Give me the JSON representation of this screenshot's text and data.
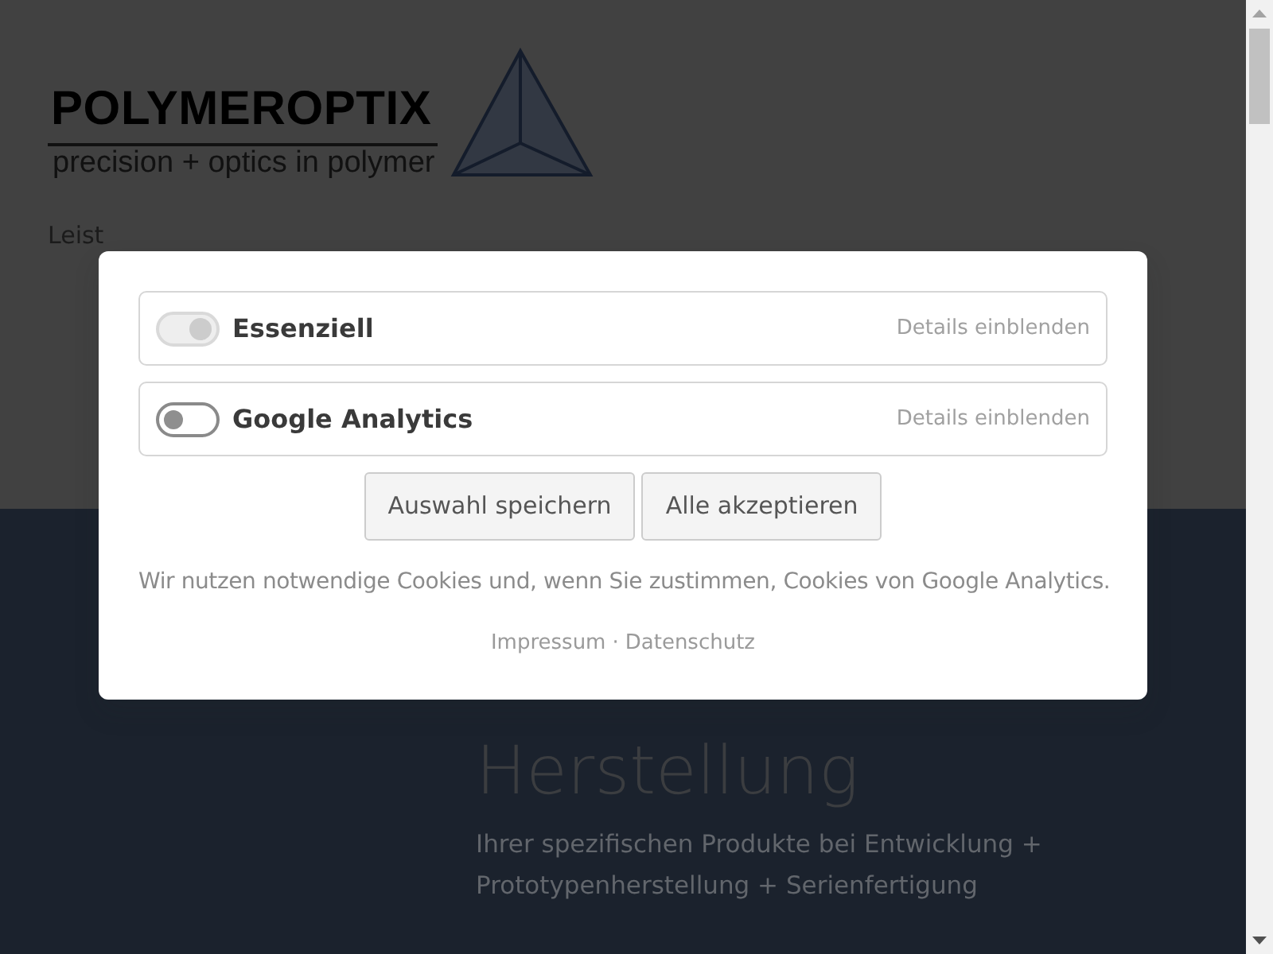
{
  "logo": {
    "name": "POLYMEROPTIX",
    "tagline": "precision + optics in polymer"
  },
  "nav": [
    {
      "label": "Leist"
    }
  ],
  "hero": {
    "title": "Herstellung",
    "subtitle": "Ihrer spezifischen Produkte bei Entwicklung + Prototypenherstellung + Serienfertigung"
  },
  "consent": {
    "categories": [
      {
        "label": "Essenziell",
        "checked": true,
        "disabled": true,
        "details": "Details einblenden"
      },
      {
        "label": "Google Analytics",
        "checked": false,
        "disabled": false,
        "details": "Details einblenden"
      }
    ],
    "buttons": [
      "Auswahl speichern",
      "Alle akzeptieren"
    ],
    "text": "Wir nutzen notwendige Cookies und, wenn Sie zustimmen, Cookies von Google Analytics.",
    "links": [
      "Impressum",
      "Datenschutz"
    ],
    "separator": "·"
  }
}
